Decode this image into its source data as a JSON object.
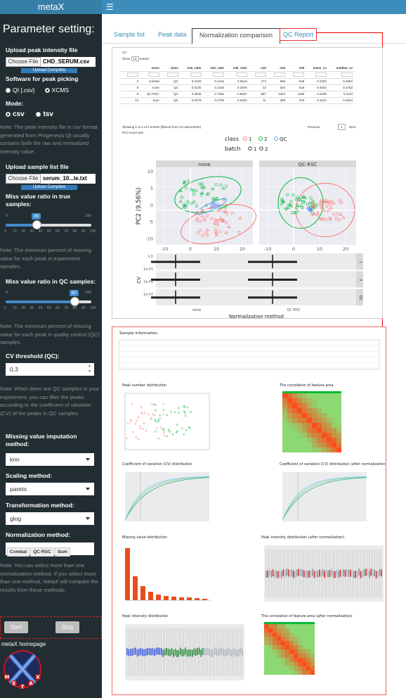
{
  "app": {
    "title": "metaX",
    "menu_icon": "hamburger-icon"
  },
  "sidebar": {
    "title": "Parameter setting:",
    "upload_peak": {
      "label": "Upload peak intensity file",
      "button": "Choose File",
      "filename": "CHD_SERUM.csv",
      "status": "Upload Complete"
    },
    "software": {
      "label": "Software for peak picking",
      "options": [
        "QI [.csv]",
        "XCMS"
      ],
      "selected": "XCMS"
    },
    "mode": {
      "label": "Mode:",
      "options": [
        "csv",
        "tsv"
      ],
      "selected": "csv"
    },
    "note_peak": "Note: The peak intensity file in csv format generated from Progenesis QI usually contains both the raw and normalized intensity value.",
    "upload_sample": {
      "label": "Upload sample list file",
      "button": "Choose File",
      "filename": "serum_10...le.txt",
      "status": "Upload Complete"
    },
    "miss_true": {
      "label": "Miss value ratio in true samples:",
      "min": "0",
      "max": "100",
      "value": "36",
      "fraction": 0.36,
      "ticks": [
        "0",
        "10",
        "20",
        "30",
        "40",
        "50",
        "60",
        "70",
        "80",
        "90",
        "100"
      ]
    },
    "note_miss_true": "Note: The minimum percent of missing value for each peak in experiment samples.",
    "miss_qc": {
      "label": "Miss value ratio in QC samples:",
      "min": "0",
      "max": "100",
      "value": "80",
      "fraction": 0.8,
      "ticks": [
        "0",
        "10",
        "20",
        "30",
        "40",
        "50",
        "60",
        "70",
        "80",
        "90",
        "100"
      ]
    },
    "note_miss_qc": "Note: The minimum percent of missing value for each peak in quality control (QC) samples.",
    "cv": {
      "label": "CV threshold (QC):",
      "value": "0.3"
    },
    "note_cv": "Note: When there are QC samples in your experiment, you can filter the peaks according to the coefficient of variation (CV) of the peaks in QC samples.",
    "imputation": {
      "label": "Missing value imputation method:",
      "value": "knn"
    },
    "scaling": {
      "label": "Scaling method:",
      "value": "pareto"
    },
    "transformation": {
      "label": "Transformation method:",
      "value": "glog"
    },
    "normalization": {
      "label": "Normalization method:",
      "chips": [
        "Combat",
        "QC-RSC",
        "Sum"
      ]
    },
    "note_norm": "Note: You can select more than one normalization method. If you select more than one method, metaX will compare the results from these methods.",
    "start": "Start",
    "stop": "Stop",
    "homepage": "metaX homepage",
    "logo_letters": [
      "M",
      "E",
      "T",
      "A",
      "X"
    ]
  },
  "tabs": [
    "Sample list",
    "Peak data",
    "Normalization comparison",
    "QC Report"
  ],
  "active_tab": "Normalization comparison",
  "comparison": {
    "table_title": "CV",
    "show_label": "Show",
    "entries_value": "10",
    "entries_label": "entries",
    "columns": [
      "norm",
      "class",
      "n10_ratio",
      "n20_ratio",
      "n30_ratio",
      "n10",
      "n20",
      "n30",
      "mean_cv",
      "median_cv"
    ],
    "rows": [
      [
        "3",
        "combat",
        "QC",
        "0.2332",
        "0.4164",
        "0.6613",
        "174",
        "565",
        "849",
        "0.2332",
        "0.2084"
      ],
      [
        "6",
        "none",
        "QC",
        "0.0130",
        "0.1440",
        "0.3678",
        "22",
        "204",
        "519",
        "0.4602",
        "0.3782"
      ],
      [
        "9",
        "QC-RSC",
        "QC",
        "0.4528",
        "0.7252",
        "0.8257",
        "587",
        "2324",
        "1169",
        "0.2209",
        "0.1143"
      ],
      [
        "12",
        "Sum",
        "QC",
        "0.0078",
        "0.2780",
        "0.5332",
        "11",
        "389",
        "753",
        "0.4222",
        "0.3044"
      ]
    ],
    "footer": "Showing 1 to 4 of 4 entries (filtered from 12 total entries)",
    "prev": "Previous",
    "next": "Next",
    "page": "1",
    "pca_title": "PCA score plot",
    "legend_class": "class",
    "legend_class_items": [
      "1",
      "2",
      "QC"
    ],
    "legend_batch": "batch",
    "legend_batch_items": [
      "1",
      "2"
    ],
    "facets": [
      "none",
      "QC-RSC"
    ],
    "xlabel": "PC1 (25.63%)",
    "ylabel": "PC2 (9.56%)",
    "x_ticks": [
      "-10",
      "0",
      "10",
      "20"
    ],
    "y_ticks": [
      "10",
      "5",
      "0",
      "-5",
      "-10"
    ],
    "cv_ylabel": "CV",
    "cv_strip": [
      "1",
      "2",
      "QC"
    ],
    "cv_xlabel": "Normalization method",
    "cv_xticks": [
      "none",
      "QC-RSC"
    ],
    "cv_yticks": [
      "1.0",
      "1e-01",
      "1e-04",
      "1e-07"
    ]
  },
  "report": {
    "sample_info": "Sample information",
    "sections": [
      "Peak number distribution",
      "The correlation of feature area",
      "Coefficient of variation (CV) distribution",
      "Coefficient of variation (CV) distribution (after normalization)",
      "Missing value distribution",
      "Peak intensity distribution (after normalization)",
      "Peak intensity distribution",
      "The correlation of feature area (after normalization)"
    ]
  },
  "colors": {
    "accent": "#3c8dbc",
    "sidebar": "#222d32",
    "class1": "#f8766d",
    "class2": "#00ba38",
    "qc": "#619cff",
    "highlight": "#e00000"
  }
}
